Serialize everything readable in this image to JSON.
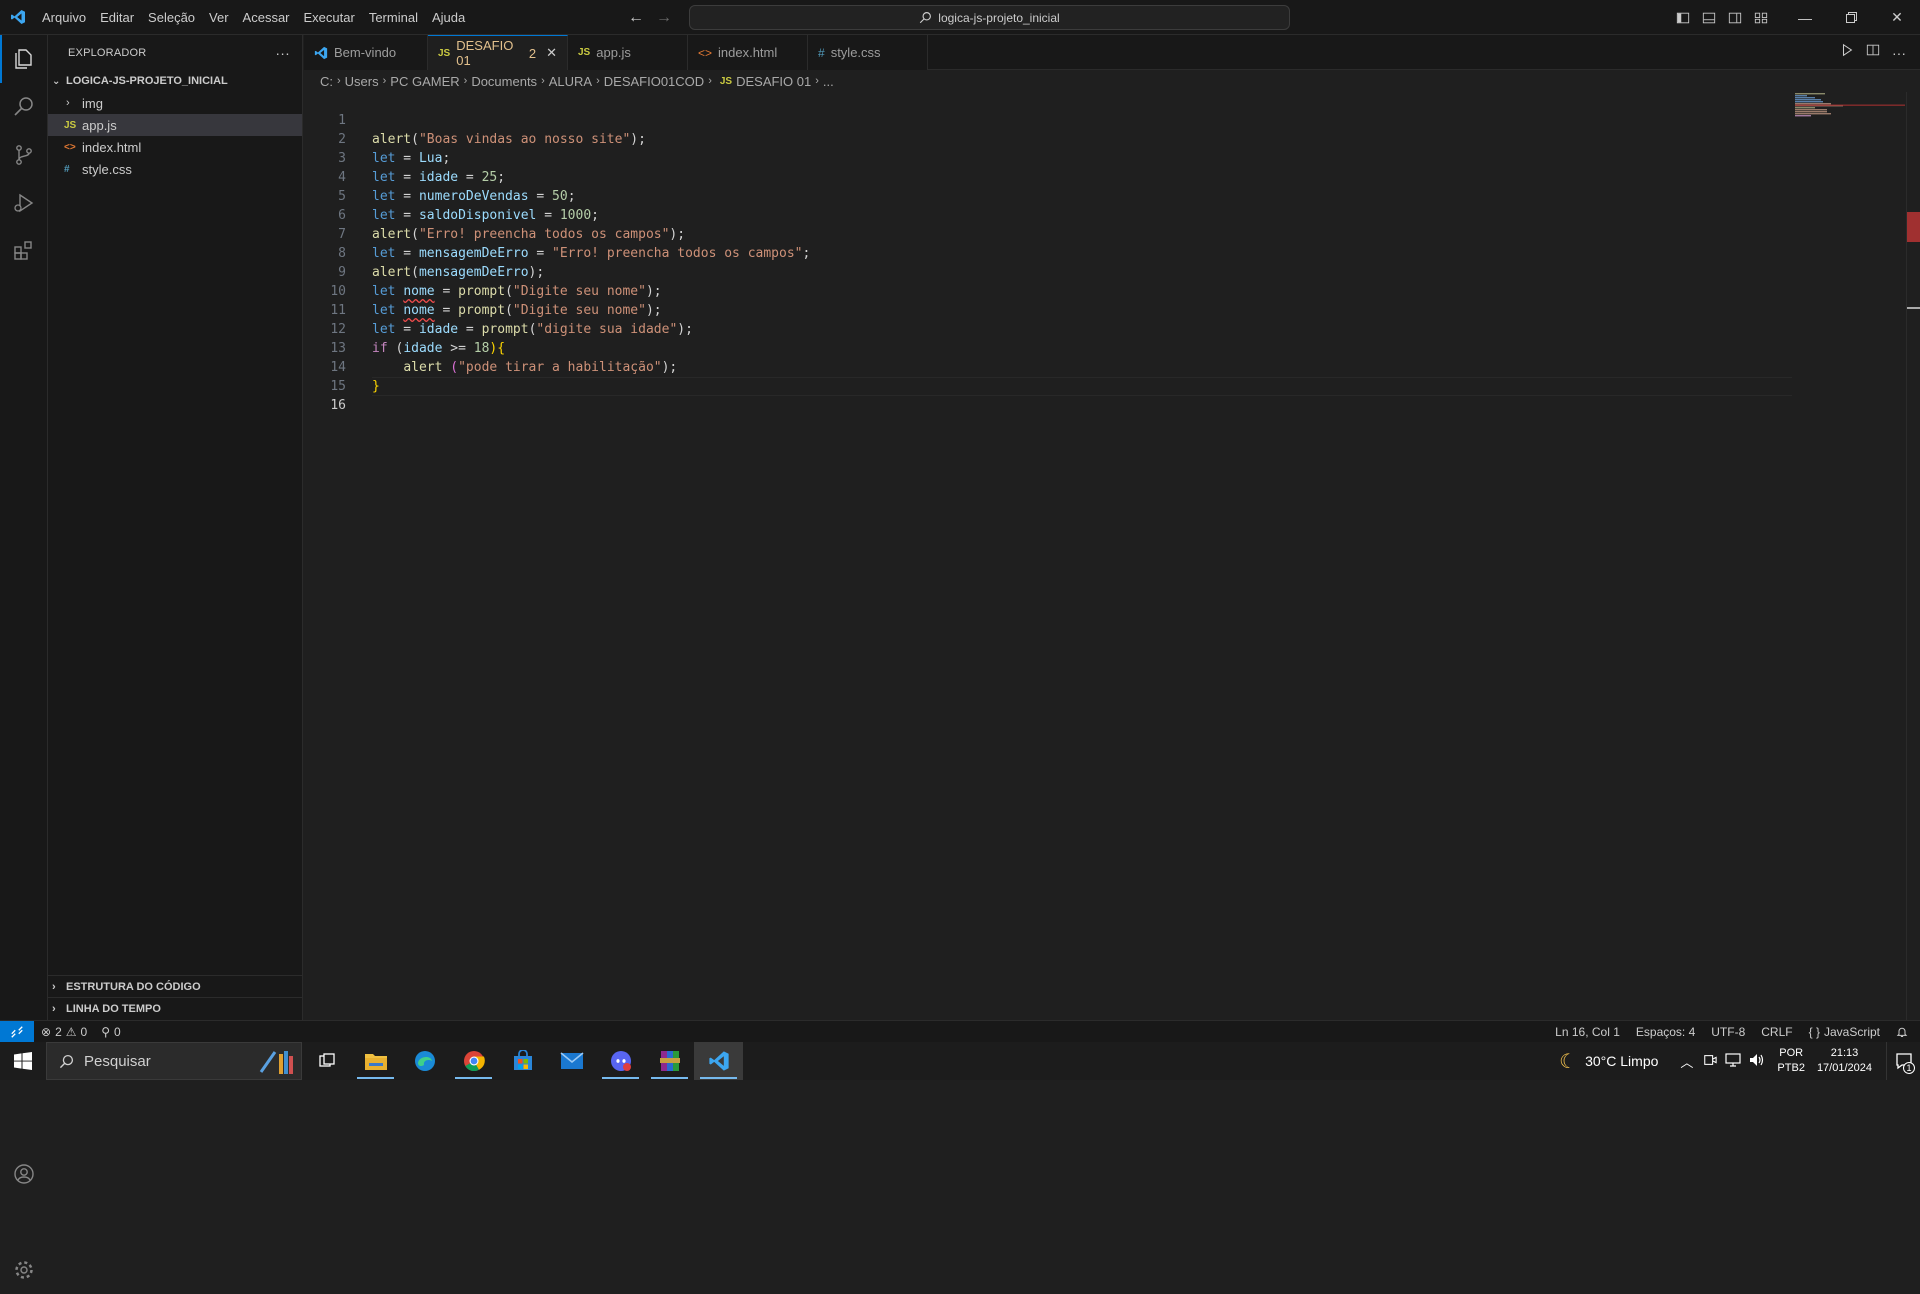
{
  "title_bar": {
    "menu": [
      "Arquivo",
      "Editar",
      "Seleção",
      "Ver",
      "Acessar",
      "Executar",
      "Terminal",
      "Ajuda"
    ],
    "search_text": "logica-js-projeto_inicial"
  },
  "sidebar": {
    "header": "EXPLORADOR",
    "more": "···",
    "root_folder": "LOGICA-JS-PROJETO_INICIAL",
    "items": [
      {
        "label": "img",
        "type": "folder"
      },
      {
        "label": "app.js",
        "type": "js",
        "icon_text": "JS"
      },
      {
        "label": "index.html",
        "type": "html",
        "icon_text": "<>"
      },
      {
        "label": "style.css",
        "type": "css",
        "icon_text": "#"
      }
    ],
    "sections": [
      "ESTRUTURA DO CÓDIGO",
      "LINHA DO TEMPO"
    ]
  },
  "tabs": [
    {
      "label": "Bem-vindo",
      "icon": "vscode-icon"
    },
    {
      "label": "DESAFIO 01",
      "badge": "2",
      "icon_text": "JS",
      "active": true
    },
    {
      "label": "app.js",
      "icon_text": "JS"
    },
    {
      "label": "index.html",
      "icon_text": "<>"
    },
    {
      "label": "style.css",
      "icon_text": "#"
    }
  ],
  "breadcrumb": [
    "C:",
    "Users",
    "PC GAMER",
    "Documents",
    "ALURA",
    "DESAFIO01COD",
    "DESAFIO 01",
    "..."
  ],
  "breadcrumb_file_icon": "JS",
  "code_lines": [
    {
      "n": "1"
    },
    {
      "n": "2"
    },
    {
      "n": "3"
    },
    {
      "n": "4"
    },
    {
      "n": "5"
    },
    {
      "n": "6"
    },
    {
      "n": "7"
    },
    {
      "n": "8"
    },
    {
      "n": "9"
    },
    {
      "n": "10"
    },
    {
      "n": "11"
    },
    {
      "n": "12"
    },
    {
      "n": "13"
    },
    {
      "n": "14"
    },
    {
      "n": "15"
    },
    {
      "n": "16"
    }
  ],
  "code": {
    "l1": [
      "alert",
      "(",
      "\"Boas vindas ao nosso site\"",
      ");"
    ],
    "l2": [
      "let",
      " = ",
      "Lua",
      ";"
    ],
    "l3": [
      "let",
      " = ",
      "idade",
      " = ",
      "25",
      ";"
    ],
    "l4": [
      "let",
      " = ",
      "numeroDeVendas",
      " = ",
      "50",
      ";"
    ],
    "l5": [
      "let",
      " = ",
      "saldoDisponivel",
      " = ",
      "1000",
      ";"
    ],
    "l6": [
      "alert",
      "(",
      "\"Erro! preencha todos os campos\"",
      ");"
    ],
    "l7": [
      "let",
      " = ",
      "mensagemDeErro",
      " = ",
      "\"Erro! preencha todos os campos\"",
      ";"
    ],
    "l8": [
      "alert",
      "(",
      "mensagemDeErro",
      ");"
    ],
    "l9": [
      "let",
      " ",
      "nome",
      " = ",
      "prompt",
      "(",
      "\"Digite seu nome\"",
      ");"
    ],
    "l10": [
      "let",
      " ",
      "nome",
      " = ",
      "prompt",
      "(",
      "\"Digite seu nome\"",
      ");"
    ],
    "l11": [
      "let",
      " = ",
      "idade",
      " = ",
      "prompt",
      "(",
      "\"digite sua idade\"",
      ");"
    ],
    "l12": [
      "if",
      " (",
      "idade",
      " >= ",
      "18",
      "){"
    ],
    "l13": [
      "    ",
      "alert",
      " (",
      "\"pode tirar a habilitação\"",
      ");"
    ],
    "l14": [
      "}"
    ]
  },
  "status_bar": {
    "errors": "2",
    "warnings": "0",
    "ports": "0",
    "position": "Ln 16, Col 1",
    "spaces": "Espaços: 4",
    "encoding": "UTF-8",
    "eol": "CRLF",
    "language": "JavaScript",
    "language_icon": "{ }"
  },
  "taskbar": {
    "search_placeholder": "Pesquisar",
    "weather": "30°C  Limpo",
    "lang_top": "POR",
    "lang_bottom": "PTB2",
    "time": "21:13",
    "date": "17/01/2024",
    "notification_count": "1"
  },
  "colors": {
    "accent": "#0078d4",
    "js_icon": "#cbcb41",
    "html_icon": "#e37933",
    "css_icon": "#519aba",
    "active_tab_text": "#e2c08d"
  }
}
